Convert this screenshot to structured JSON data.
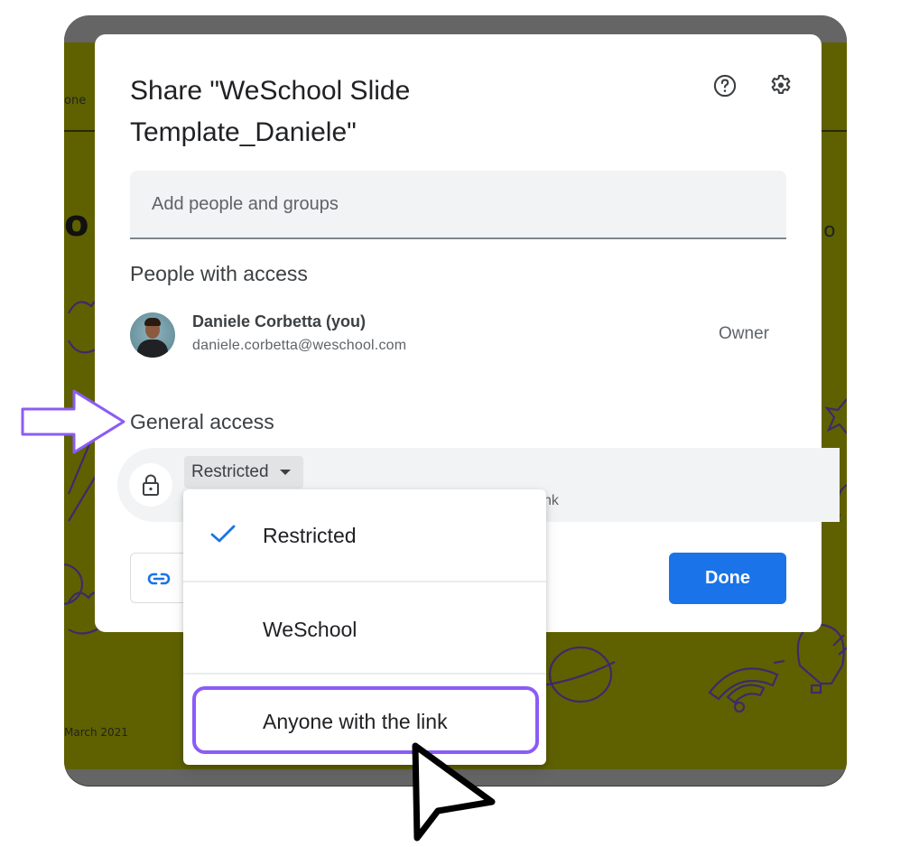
{
  "background_slide": {
    "fragments": {
      "top_left": "one",
      "big_letter": "o",
      "right_fragment": "lo",
      "date": "March 2021"
    },
    "colors": {
      "slide": "#5f6100",
      "frame": "#646564",
      "doodle": "#3d2a6b"
    }
  },
  "dialog": {
    "title": "Share \"WeSchool Slide Template_Daniele\"",
    "help_icon": "help-circle-icon",
    "settings_icon": "gear-icon",
    "add_people": {
      "placeholder": "Add people and groups",
      "value": ""
    },
    "people_section_title": "People with access",
    "people": [
      {
        "name": "Daniele Corbetta (you)",
        "email": "daniele.corbetta@weschool.com",
        "role": "Owner",
        "avatar": "avatar-photo"
      }
    ],
    "general_access": {
      "title": "General access",
      "icon": "lock-icon",
      "selected": "Restricted",
      "description_fragment": "nk"
    },
    "copy_link_icon": "link-icon",
    "done_label": "Done",
    "accent_color": "#1a73e8"
  },
  "access_menu": {
    "items": [
      {
        "label": "Restricted",
        "checked": true
      },
      {
        "label": "WeSchool",
        "checked": false
      },
      {
        "label": "Anyone with the link",
        "checked": false,
        "highlighted": true
      }
    ],
    "highlight_color": "#8b5cf6"
  },
  "annotations": {
    "arrow_target": "General access",
    "cursor_target": "Anyone with the link"
  }
}
